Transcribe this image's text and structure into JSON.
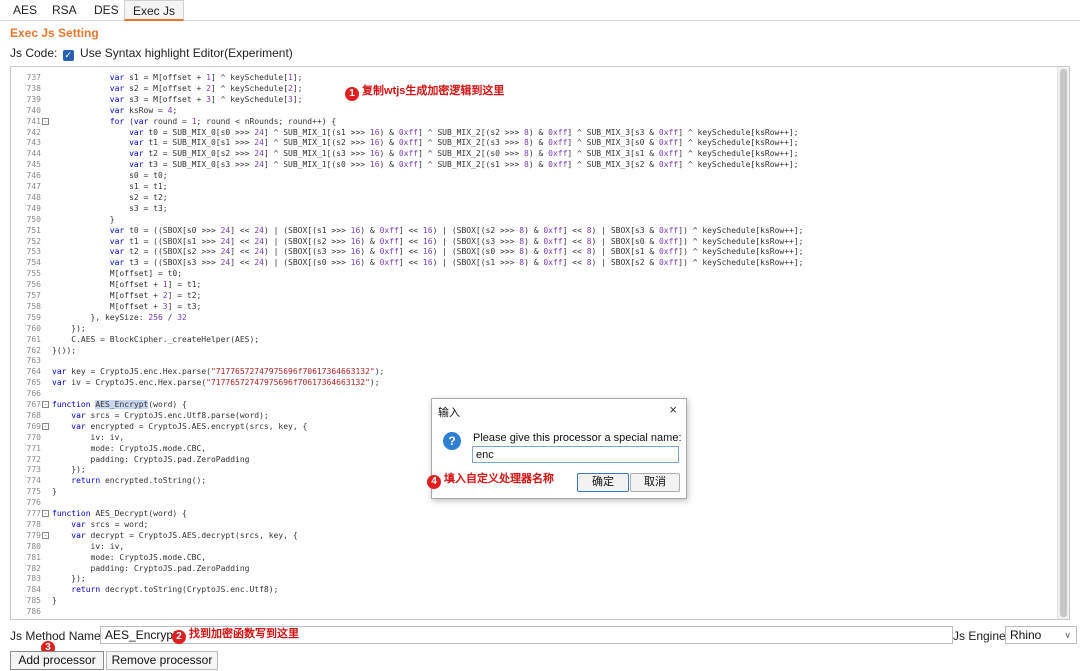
{
  "tabs": [
    {
      "label": "AES"
    },
    {
      "label": "RSA"
    },
    {
      "label": "DES"
    },
    {
      "label": "Exec Js",
      "active": true
    }
  ],
  "setting_title": "Exec Js Setting",
  "jscode": {
    "label": "Js Code:",
    "checkbox_label": "Use Syntax highlight Editor(Experiment)",
    "checked": true
  },
  "editor": {
    "lines": [
      {
        "n": "737",
        "t": "            var s1 = M[offset + 1] ^ keySchedule[1];"
      },
      {
        "n": "738",
        "t": "            var s2 = M[offset + 2] ^ keySchedule[2];"
      },
      {
        "n": "739",
        "t": "            var s3 = M[offset + 3] ^ keySchedule[3];"
      },
      {
        "n": "740",
        "t": "            var ksRow = 4;"
      },
      {
        "n": "741",
        "t": "            for (var round = 1; round < nRounds; round++) {",
        "fold": true
      },
      {
        "n": "742",
        "t": "                var t0 = SUB_MIX_0[s0 >>> 24] ^ SUB_MIX_1[(s1 >>> 16) & 0xff] ^ SUB_MIX_2[(s2 >>> 8) & 0xff] ^ SUB_MIX_3[s3 & 0xff] ^ keySchedule[ksRow++];"
      },
      {
        "n": "743",
        "t": "                var t1 = SUB_MIX_0[s1 >>> 24] ^ SUB_MIX_1[(s2 >>> 16) & 0xff] ^ SUB_MIX_2[(s3 >>> 8) & 0xff] ^ SUB_MIX_3[s0 & 0xff] ^ keySchedule[ksRow++];"
      },
      {
        "n": "744",
        "t": "                var t2 = SUB_MIX_0[s2 >>> 24] ^ SUB_MIX_1[(s3 >>> 16) & 0xff] ^ SUB_MIX_2[(s0 >>> 8) & 0xff] ^ SUB_MIX_3[s1 & 0xff] ^ keySchedule[ksRow++];"
      },
      {
        "n": "745",
        "t": "                var t3 = SUB_MIX_0[s3 >>> 24] ^ SUB_MIX_1[(s0 >>> 16) & 0xff] ^ SUB_MIX_2[(s1 >>> 8) & 0xff] ^ SUB_MIX_3[s2 & 0xff] ^ keySchedule[ksRow++];"
      },
      {
        "n": "746",
        "t": "                s0 = t0;"
      },
      {
        "n": "747",
        "t": "                s1 = t1;"
      },
      {
        "n": "748",
        "t": "                s2 = t2;"
      },
      {
        "n": "749",
        "t": "                s3 = t3;"
      },
      {
        "n": "750",
        "t": "            }"
      },
      {
        "n": "751",
        "t": "            var t0 = ((SBOX[s0 >>> 24] << 24) | (SBOX[(s1 >>> 16) & 0xff] << 16) | (SBOX[(s2 >>> 8) & 0xff] << 8) | SBOX[s3 & 0xff]) ^ keySchedule[ksRow++];"
      },
      {
        "n": "752",
        "t": "            var t1 = ((SBOX[s1 >>> 24] << 24) | (SBOX[(s2 >>> 16) & 0xff] << 16) | (SBOX[(s3 >>> 8) & 0xff] << 8) | SBOX[s0 & 0xff]) ^ keySchedule[ksRow++];"
      },
      {
        "n": "753",
        "t": "            var t2 = ((SBOX[s2 >>> 24] << 24) | (SBOX[(s3 >>> 16) & 0xff] << 16) | (SBOX[(s0 >>> 8) & 0xff] << 8) | SBOX[s1 & 0xff]) ^ keySchedule[ksRow++];"
      },
      {
        "n": "754",
        "t": "            var t3 = ((SBOX[s3 >>> 24] << 24) | (SBOX[(s0 >>> 16) & 0xff] << 16) | (SBOX[(s1 >>> 8) & 0xff] << 8) | SBOX[s2 & 0xff]) ^ keySchedule[ksRow++];"
      },
      {
        "n": "755",
        "t": "            M[offset] = t0;"
      },
      {
        "n": "756",
        "t": "            M[offset + 1] = t1;"
      },
      {
        "n": "757",
        "t": "            M[offset + 2] = t2;"
      },
      {
        "n": "758",
        "t": "            M[offset + 3] = t3;"
      },
      {
        "n": "759",
        "t": "        }, keySize: 256 / 32"
      },
      {
        "n": "760",
        "t": "    });"
      },
      {
        "n": "761",
        "t": "    C.AES = BlockCipher._createHelper(AES);"
      },
      {
        "n": "762",
        "t": "}());"
      },
      {
        "n": "763",
        "t": ""
      },
      {
        "n": "764",
        "t": "var key = CryptoJS.enc.Hex.parse(\"71776572747975696f70617364663132\");"
      },
      {
        "n": "765",
        "t": "var iv = CryptoJS.enc.Hex.parse(\"71776572747975696f70617364663132\");"
      },
      {
        "n": "766",
        "t": ""
      },
      {
        "n": "767",
        "t": "function AES_Encrypt(word) {",
        "fold": true
      },
      {
        "n": "768",
        "t": "    var srcs = CryptoJS.enc.Utf8.parse(word);"
      },
      {
        "n": "769",
        "t": "    var encrypted = CryptoJS.AES.encrypt(srcs, key, {",
        "fold": true
      },
      {
        "n": "770",
        "t": "        iv: iv,"
      },
      {
        "n": "771",
        "t": "        mode: CryptoJS.mode.CBC,"
      },
      {
        "n": "772",
        "t": "        padding: CryptoJS.pad.ZeroPadding"
      },
      {
        "n": "773",
        "t": "    });"
      },
      {
        "n": "774",
        "t": "    return encrypted.toString();"
      },
      {
        "n": "775",
        "t": "}"
      },
      {
        "n": "776",
        "t": ""
      },
      {
        "n": "777",
        "t": "function AES_Decrypt(word) {",
        "fold": true
      },
      {
        "n": "778",
        "t": "    var srcs = word;"
      },
      {
        "n": "779",
        "t": "    var decrypt = CryptoJS.AES.decrypt(srcs, key, {",
        "fold": true
      },
      {
        "n": "780",
        "t": "        iv: iv,"
      },
      {
        "n": "781",
        "t": "        mode: CryptoJS.mode.CBC,"
      },
      {
        "n": "782",
        "t": "        padding: CryptoJS.pad.ZeroPadding"
      },
      {
        "n": "783",
        "t": "    });"
      },
      {
        "n": "784",
        "t": "    return decrypt.toString(CryptoJS.enc.Utf8);"
      },
      {
        "n": "785",
        "t": "}"
      },
      {
        "n": "786",
        "t": ""
      }
    ],
    "highlight_word": "AES_Encrypt"
  },
  "annotations": {
    "a1": {
      "num": "1",
      "text": "复制wtjs生成加密逻辑到这里"
    },
    "a2": {
      "num": "2",
      "text": "找到加密函数写到这里"
    },
    "a3": {
      "num": "3",
      "text": ""
    },
    "a4": {
      "num": "4",
      "text": "填入自定义处理器名称"
    }
  },
  "dialog": {
    "title": "输入",
    "close": "×",
    "icon": "question-icon",
    "message": "Please give this processor a special name:",
    "value": "enc",
    "ok": "确定",
    "cancel": "取消"
  },
  "method": {
    "label": "Js Method Name:",
    "value": "AES_Encrypt"
  },
  "engine": {
    "label": "Js Engine:",
    "value": "Rhino"
  },
  "buttons": {
    "add": "Add processor",
    "remove": "Remove processor"
  },
  "colors": {
    "accent": "#e8772e",
    "annotation_red": "#e02020",
    "keyword": "#0000cc",
    "string": "#b22222"
  }
}
